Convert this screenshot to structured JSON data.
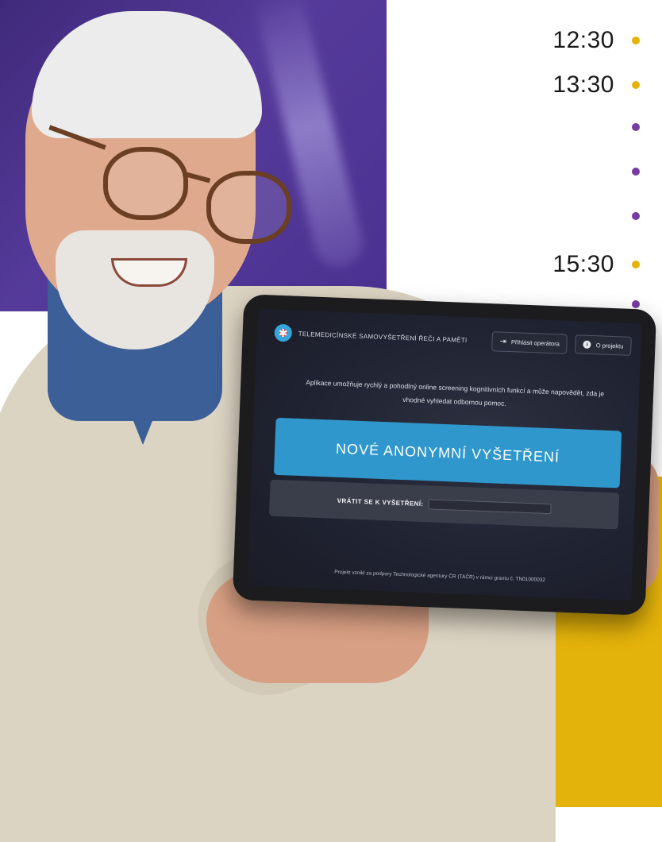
{
  "schedule": {
    "rows": [
      {
        "time": "12:30",
        "dot": "yellow"
      },
      {
        "time": "13:30",
        "dot": "yellow"
      },
      {
        "time": "",
        "dot": "purple"
      },
      {
        "time": "",
        "dot": "purple"
      },
      {
        "time": "",
        "dot": "purple"
      },
      {
        "time": "15:30",
        "dot": "yellow"
      },
      {
        "time": "",
        "dot": "purple"
      }
    ]
  },
  "colors": {
    "yellow": "#e4b30b",
    "purple": "#7a3aa3",
    "background_purple": "#4a3190",
    "button_blue": "#2f97cc"
  },
  "tablet_app": {
    "title": "TELEMEDICÍNSKÉ SAMOVYŠETŘENÍ ŘEČI A PAMĚTI",
    "logo_icon": "brain-logo-icon",
    "operator_login_label": "Přihlásit operátora",
    "about_label": "O projektu",
    "description": "Aplikace umožňuje rychlý a pohodlný online screening kognitivních funkcí a může napovědět, zda je vhodné vyhledat odbornou pomoc.",
    "new_exam_label": "NOVÉ ANONYMNÍ VYŠETŘENÍ",
    "return_label": "VRÁTIT SE K VYŠETŘENÍ:",
    "return_input_value": "",
    "footer": "Projekt vznikl za podpory Technologické agentury ČR (TAČR) v rámci grantu č. TN01000032"
  }
}
